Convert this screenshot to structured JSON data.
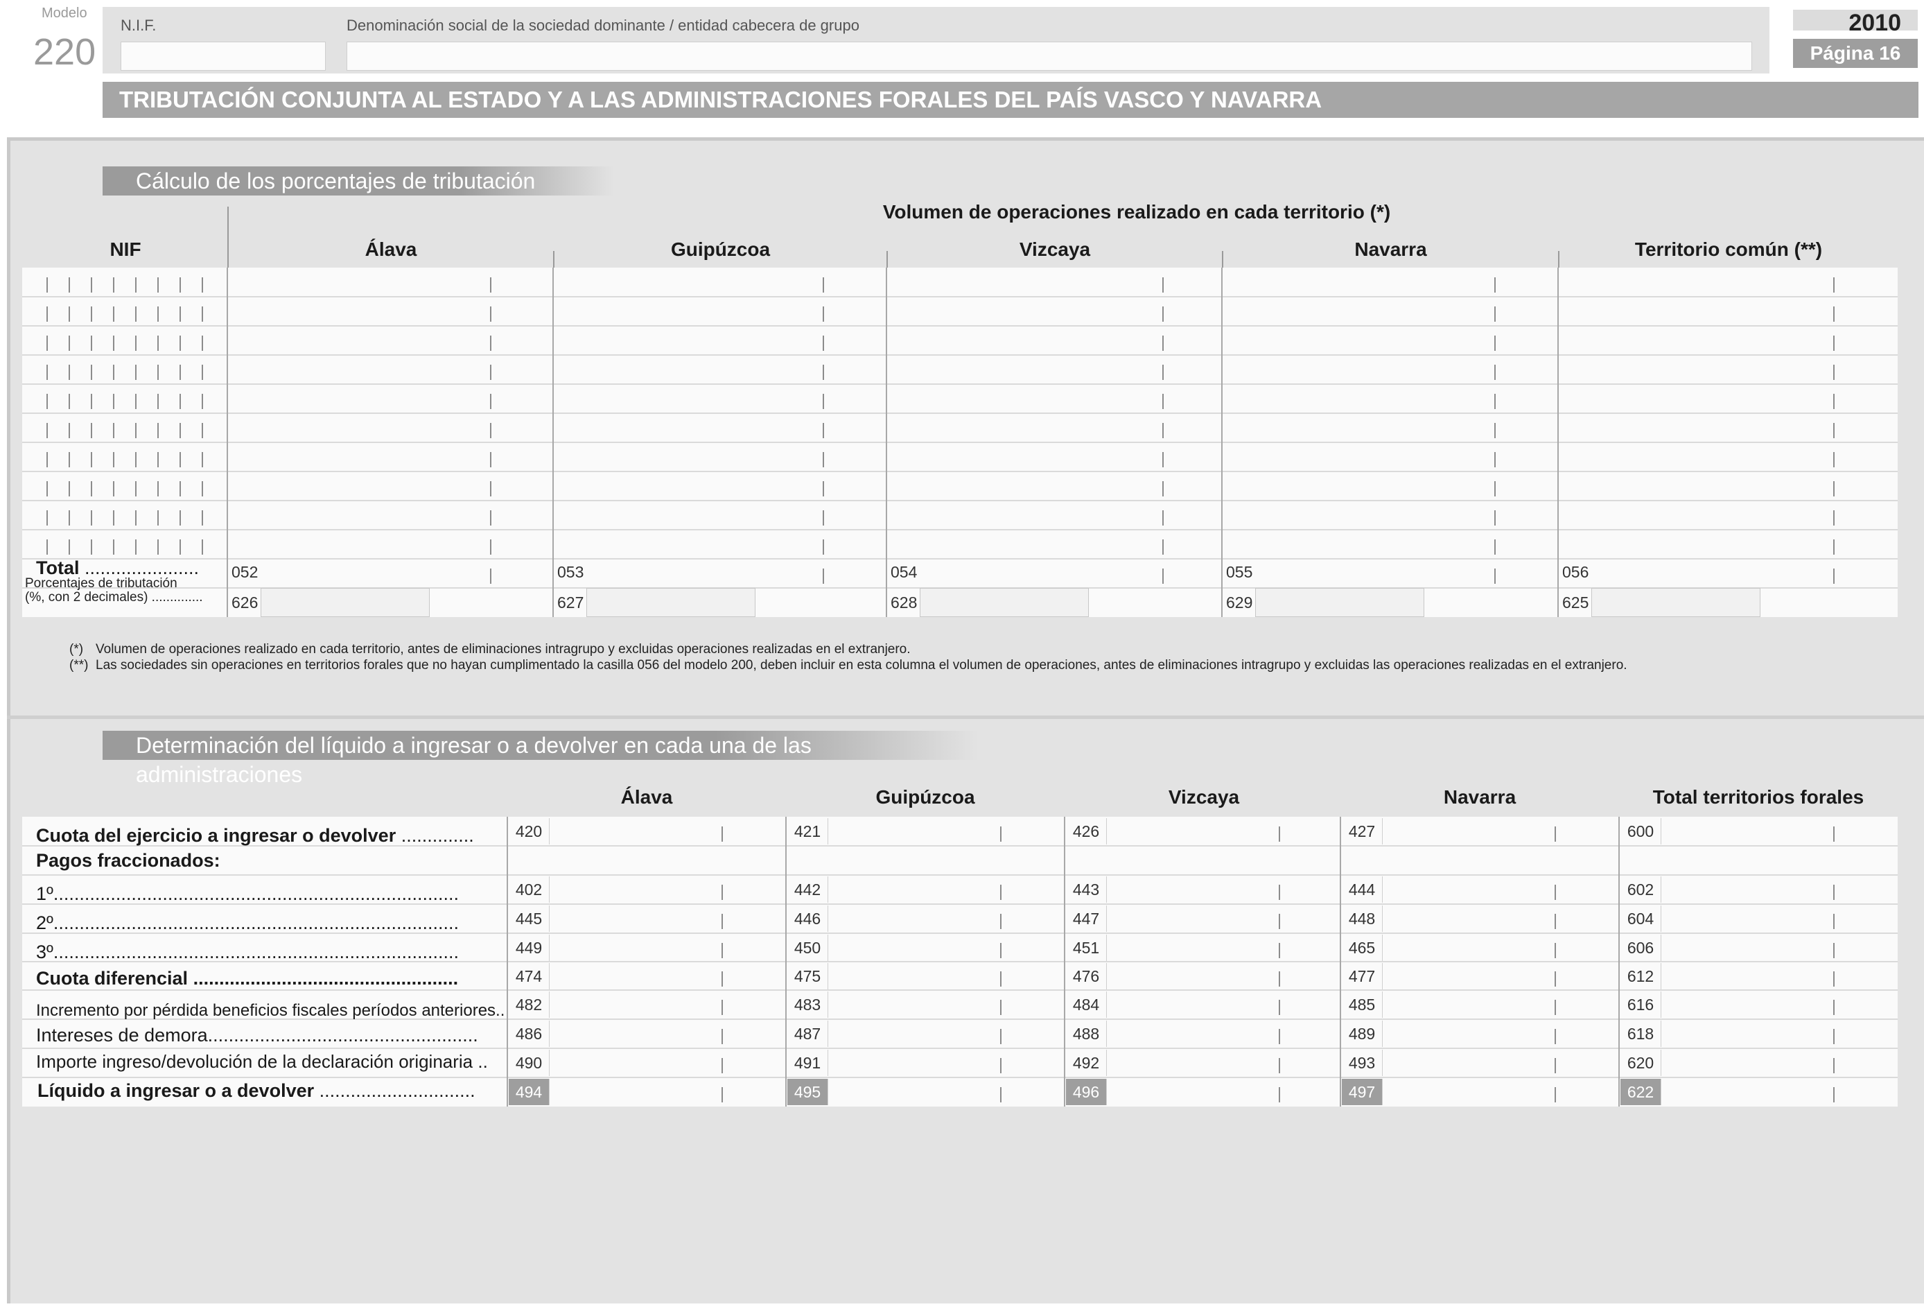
{
  "header": {
    "modelo_label": "Modelo",
    "modelo_number": "220",
    "nif_label": "N.I.F.",
    "denominacion_label": "Denominación social de la sociedad dominante / entidad cabecera de grupo",
    "year": "2010",
    "page": "Página 16",
    "title": "TRIBUTACIÓN CONJUNTA AL ESTADO Y A LAS ADMINISTRACIONES FORALES DEL PAÍS VASCO Y NAVARRA"
  },
  "section1": {
    "title": "Cálculo de los porcentajes de tributación",
    "volume_header": "Volumen de operaciones realizado en cada territorio (*)",
    "columns": [
      "NIF",
      "Álava",
      "Guipúzcoa",
      "Vizcaya",
      "Navarra",
      "Territorio común (**)"
    ],
    "total_label": "Total",
    "total_dots": "......................",
    "total_codes": [
      "052",
      "053",
      "054",
      "055",
      "056"
    ],
    "pct_label_1": "Porcentajes de tributación",
    "pct_label_2": "(%, con 2 decimales) ..............",
    "pct_codes": [
      "626",
      "627",
      "628",
      "629",
      "625"
    ],
    "notes": [
      {
        "mark": "(*)",
        "text": "Volumen de operaciones realizado en cada territorio, antes de eliminaciones intragrupo y excluidas operaciones realizadas en el extranjero."
      },
      {
        "mark": "(**)",
        "text": "Las sociedades sin operaciones en territorios forales que no hayan cumplimentado la casilla 056 del modelo 200, deben incluir en esta columna el volumen de operaciones, antes de eliminaciones intragrupo y excluidas las operaciones realizadas en el extranjero."
      }
    ]
  },
  "section2": {
    "title": "Determinación del líquido a ingresar o a devolver en cada una de las administraciones",
    "columns": [
      "Álava",
      "Guipúzcoa",
      "Vizcaya",
      "Navarra",
      "Total territorios forales"
    ],
    "pagos_label": "Pagos fraccionados:",
    "rows": [
      {
        "label": "Cuota del ejercicio a ingresar o devolver",
        "dots": "..............",
        "bold": true,
        "codes": [
          "420",
          "421",
          "426",
          "427",
          "600"
        ]
      },
      {
        "label": "1º",
        "dots": "..............................................................................",
        "bold": false,
        "codes": [
          "402",
          "442",
          "443",
          "444",
          "602"
        ]
      },
      {
        "label": "2º",
        "dots": "..............................................................................",
        "bold": false,
        "codes": [
          "445",
          "446",
          "447",
          "448",
          "604"
        ]
      },
      {
        "label": "3º",
        "dots": "..............................................................................",
        "bold": false,
        "codes": [
          "449",
          "450",
          "451",
          "465",
          "606"
        ]
      },
      {
        "label": "Cuota diferencial",
        "dots": "...................................................",
        "bold": true,
        "codes": [
          "474",
          "475",
          "476",
          "477",
          "612"
        ]
      },
      {
        "label": "Incremento por pérdida beneficios fiscales períodos anteriores..",
        "dots": "",
        "bold": false,
        "codes": [
          "482",
          "483",
          "484",
          "485",
          "616"
        ]
      },
      {
        "label": "Intereses de demora",
        "dots": "....................................................",
        "bold": false,
        "codes": [
          "486",
          "487",
          "488",
          "489",
          "618"
        ]
      },
      {
        "label": "Importe ingreso/devolución de la declaración originaria ..",
        "dots": "",
        "bold": false,
        "codes": [
          "490",
          "491",
          "492",
          "493",
          "620"
        ]
      },
      {
        "label": "Líquido a ingresar o a devolver",
        "dots": "..............................",
        "bold": true,
        "codes": [
          "494",
          "495",
          "496",
          "497",
          "622"
        ]
      }
    ]
  }
}
